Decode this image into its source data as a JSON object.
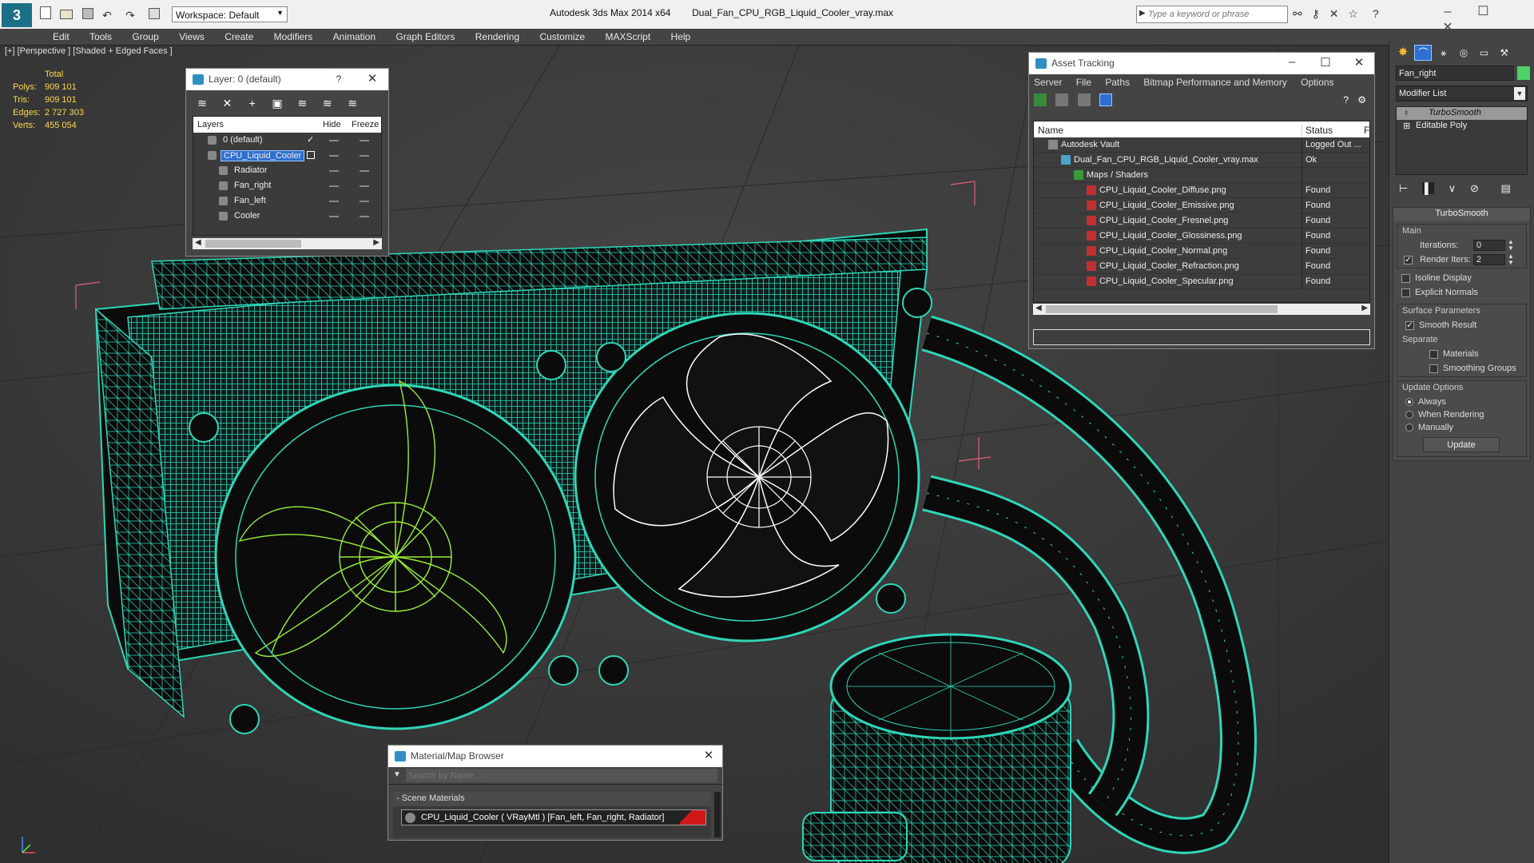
{
  "app": {
    "title_left": "Autodesk 3ds Max  2014 x64",
    "title_file": "Dual_Fan_CPU_RGB_Liquid_Cooler_vray.max",
    "workspace": "Workspace: Default",
    "search_placeholder": "Type a keyword or phrase"
  },
  "menu": [
    "Edit",
    "Tools",
    "Group",
    "Views",
    "Create",
    "Modifiers",
    "Animation",
    "Graph Editors",
    "Rendering",
    "Customize",
    "MAXScript",
    "Help"
  ],
  "viewport": {
    "label": "[+] [Perspective ] [Shaded + Edged Faces ]",
    "stats": {
      "header": "Total",
      "rows": [
        {
          "label": "Polys:",
          "value": "909 101"
        },
        {
          "label": "Tris:",
          "value": "909 101"
        },
        {
          "label": "Edges:",
          "value": "2 727 303"
        },
        {
          "label": "Verts:",
          "value": "455 054"
        }
      ]
    }
  },
  "layer_window": {
    "title": "Layer: 0 (default)",
    "help": "?",
    "columns": [
      "Layers",
      "Hide",
      "Freeze"
    ],
    "rows": [
      {
        "name": "0 (default)",
        "indent": 1,
        "selected": false
      },
      {
        "name": "CPU_Liquid_Cooler",
        "indent": 1,
        "selected": true
      },
      {
        "name": "Radiator",
        "indent": 2,
        "selected": false
      },
      {
        "name": "Fan_right",
        "indent": 2,
        "selected": false
      },
      {
        "name": "Fan_left",
        "indent": 2,
        "selected": false
      },
      {
        "name": "Cooler",
        "indent": 2,
        "selected": false
      }
    ]
  },
  "asset_window": {
    "title": "Asset Tracking",
    "menu": [
      "Server",
      "File",
      "Paths",
      "Bitmap Performance and Memory",
      "Options"
    ],
    "columns": [
      "Name",
      "Status",
      "F"
    ],
    "rows": [
      {
        "name": "Autodesk Vault",
        "status": "Logged Out ...",
        "indent": 1
      },
      {
        "name": "Dual_Fan_CPU_RGB_Liquid_Cooler_vray.max",
        "status": "Ok",
        "indent": 2
      },
      {
        "name": "Maps / Shaders",
        "status": "",
        "indent": 3
      },
      {
        "name": "CPU_Liquid_Cooler_Diffuse.png",
        "status": "Found",
        "indent": 4
      },
      {
        "name": "CPU_Liquid_Cooler_Emissive.png",
        "status": "Found",
        "indent": 4
      },
      {
        "name": "CPU_Liquid_Cooler_Fresnel.png",
        "status": "Found",
        "indent": 4
      },
      {
        "name": "CPU_Liquid_Cooler_Glossiness.png",
        "status": "Found",
        "indent": 4
      },
      {
        "name": "CPU_Liquid_Cooler_Normal.png",
        "status": "Found",
        "indent": 4
      },
      {
        "name": "CPU_Liquid_Cooler_Refraction.png",
        "status": "Found",
        "indent": 4
      },
      {
        "name": "CPU_Liquid_Cooler_Specular.png",
        "status": "Found",
        "indent": 4
      }
    ]
  },
  "material_window": {
    "title": "Material/Map Browser",
    "search_placeholder": "Search by Name ...",
    "section": "- Scene Materials",
    "material": "CPU_Liquid_Cooler  ( VRayMtl ) [Fan_left, Fan_right, Radiator]"
  },
  "command_panel": {
    "object_name": "Fan_right",
    "object_color": "#4fd16a",
    "modifier_list": "Modifier List",
    "stack": [
      "TurboSmooth",
      "Editable Poly"
    ],
    "turbosmooth": {
      "title": "TurboSmooth",
      "main": "Main",
      "iterations_label": "Iterations:",
      "iterations": "0",
      "render_iters_label": "Render Iters:",
      "render_iters": "2",
      "isoline": "Isoline Display",
      "explicit": "Explicit Normals",
      "surface_params": "Surface Parameters",
      "smooth_result": "Smooth Result",
      "separate": "Separate",
      "materials": "Materials",
      "smoothing_groups": "Smoothing Groups",
      "update_options": "Update Options",
      "always": "Always",
      "when_rendering": "When Rendering",
      "manually": "Manually",
      "update_button": "Update"
    }
  },
  "colors": {
    "wire": "#2fd6b8",
    "wire_selected": "#ffffff",
    "wire_green": "#9aef3a",
    "bbox": "#e0607a"
  }
}
